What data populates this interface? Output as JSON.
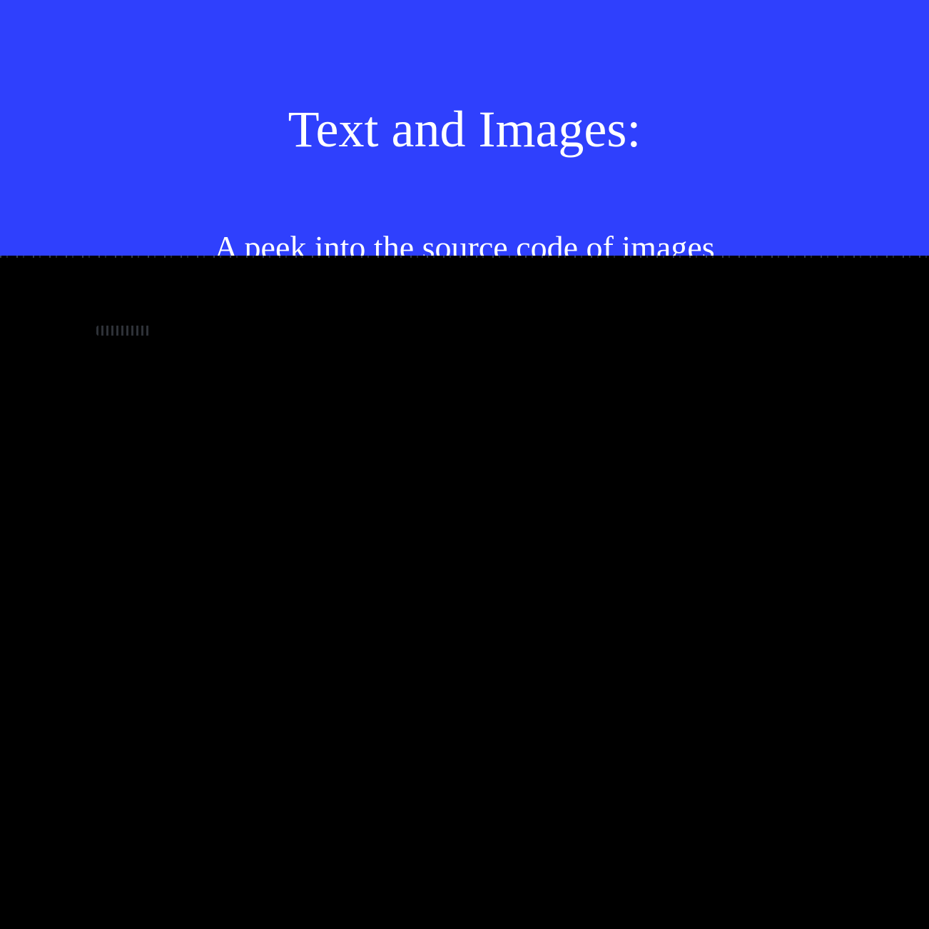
{
  "slide": {
    "title": "Text and Images:",
    "subtitle": "A peek into the source code of images"
  },
  "colors": {
    "banner_background": "#2f40fd",
    "text": "#ffffff",
    "lower_background": "#000000"
  }
}
